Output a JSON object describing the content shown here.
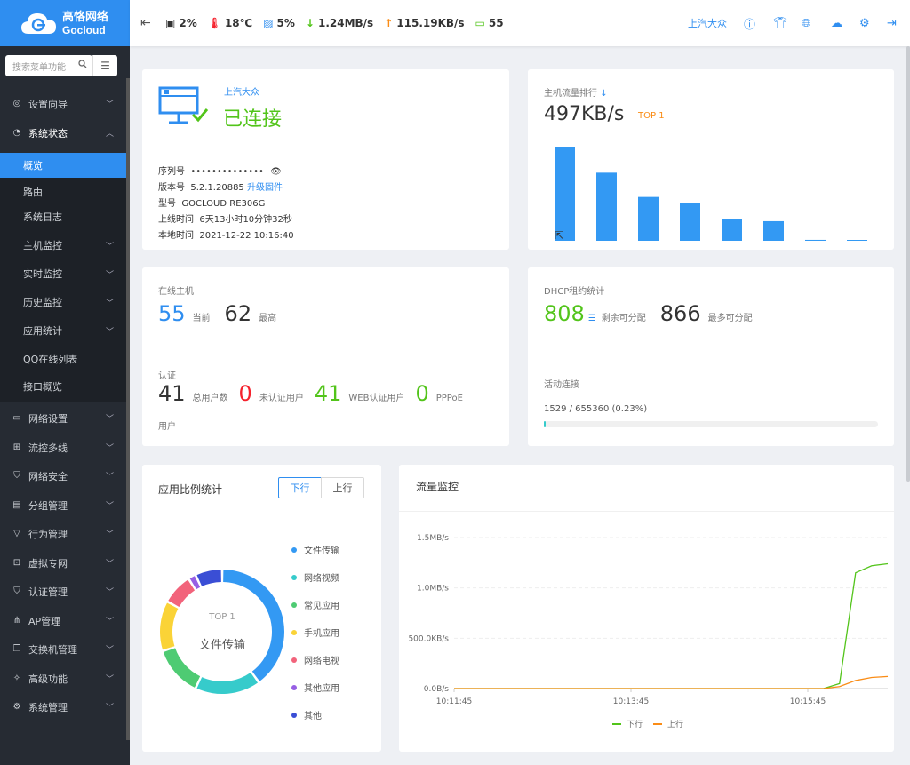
{
  "brand": {
    "cn": "高恪网络",
    "en": "Gocloud"
  },
  "sidebar": {
    "search_placeholder": "搜索菜单功能",
    "groups": [
      {
        "label": "设置向导",
        "icon": "compass-icon"
      },
      {
        "label": "系统状态",
        "icon": "dashboard-icon"
      },
      {
        "label": "网络设置",
        "icon": "monitor-icon"
      },
      {
        "label": "流控多线",
        "icon": "network-icon"
      },
      {
        "label": "网络安全",
        "icon": "shield-icon"
      },
      {
        "label": "分组管理",
        "icon": "list-icon"
      },
      {
        "label": "行为管理",
        "icon": "filter-icon"
      },
      {
        "label": "虚拟专网",
        "icon": "vpn-icon"
      },
      {
        "label": "认证管理",
        "icon": "check-shield-icon"
      },
      {
        "label": "AP管理",
        "icon": "tree-icon"
      },
      {
        "label": "交换机管理",
        "icon": "copy-icon"
      },
      {
        "label": "高级功能",
        "icon": "pin-icon"
      },
      {
        "label": "系统管理",
        "icon": "gear-icon"
      }
    ],
    "status_sub": [
      {
        "label": "概览"
      },
      {
        "label": "路由"
      },
      {
        "label": "系统日志"
      },
      {
        "label": "主机监控"
      },
      {
        "label": "实时监控"
      },
      {
        "label": "历史监控"
      },
      {
        "label": "应用统计"
      },
      {
        "label": "QQ在线列表"
      },
      {
        "label": "接口概览"
      }
    ]
  },
  "topbar": {
    "cpu": "2%",
    "temp": "18℃",
    "mem": "5%",
    "down": "1.24MB/s",
    "up": "115.19KB/s",
    "hosts": "55",
    "user": "上汽大众"
  },
  "device": {
    "name": "上汽大众",
    "status": "已连接",
    "serial_label": "序列号",
    "serial_value": "••••••••••••••",
    "version_label": "版本号",
    "version_value": "5.2.1.20885",
    "upgrade_link": "升级固件",
    "model_label": "型号",
    "model_value": "GOCLOUD RE306G",
    "uptime_label": "上线时间",
    "uptime_value": "6天13小时10分钟32秒",
    "localtime_label": "本地时间",
    "localtime_value": "2021-12-22 10:16:40"
  },
  "ranking": {
    "title": "主机流量排行",
    "value": "497KB/s",
    "badge": "TOP 1"
  },
  "hosts": {
    "title": "在线主机",
    "current": "55",
    "current_label": "当前",
    "max": "62",
    "max_label": "最高",
    "auth_title": "认证",
    "total": "41",
    "total_label": "总用户数",
    "unauth": "0",
    "unauth_label": "未认证用户",
    "web": "41",
    "web_label": "WEB认证用户",
    "pppoe": "0",
    "pppoe_label": "PPPoE",
    "pppoe_label2": "用户"
  },
  "dhcp": {
    "title": "DHCP租约统计",
    "remain": "808",
    "remain_label": "剩余可分配",
    "max": "866",
    "max_label": "最多可分配",
    "conn_title": "活动连接",
    "conn_value": "1529 / 655360 (0.23%)",
    "conn_fraction": 0.0023
  },
  "apps": {
    "title": "应用比例统计",
    "tab_down": "下行",
    "tab_up": "上行",
    "center_top": "TOP 1",
    "center_label": "文件传输",
    "legend": [
      {
        "name": "文件传输",
        "color": "#3399f3"
      },
      {
        "name": "网络视频",
        "color": "#36cbcb"
      },
      {
        "name": "常见应用",
        "color": "#4ecb73"
      },
      {
        "name": "手机应用",
        "color": "#fad337"
      },
      {
        "name": "网络电视",
        "color": "#f2637b"
      },
      {
        "name": "其他应用",
        "color": "#975fe4"
      },
      {
        "name": "其他",
        "color": "#3a4ed5"
      }
    ]
  },
  "chart_data": [
    {
      "type": "bar",
      "values": [
        100,
        73,
        47,
        40,
        23,
        21,
        1,
        0.5
      ],
      "ylim": [
        0,
        100
      ]
    },
    {
      "type": "pie",
      "title": "",
      "categories": [
        "文件传输",
        "网络视频",
        "常见应用",
        "手机应用",
        "网络电视",
        "其他应用",
        "其他"
      ],
      "values": [
        40,
        17,
        13,
        13,
        8,
        2,
        7
      ]
    },
    {
      "type": "line",
      "title": "流量监控",
      "x": [
        "10:11:45",
        "10:13:45",
        "10:15:45"
      ],
      "yticks": [
        "0.0B/s",
        "500.0KB/s",
        "1.0MB/s",
        "1.5MB/s"
      ],
      "ylim": [
        0,
        1.5
      ],
      "series": [
        {
          "name": "下行",
          "color": "#52c41a",
          "values": [
            0,
            0,
            0,
            0,
            0,
            0,
            0,
            0,
            0,
            0,
            0,
            0,
            0,
            0,
            0,
            0,
            0,
            0,
            0,
            0,
            0,
            0,
            0,
            0,
            0.05,
            1.15,
            1.22,
            1.24
          ]
        },
        {
          "name": "上行",
          "color": "#fa8c16",
          "values": [
            0,
            0,
            0,
            0,
            0,
            0,
            0,
            0,
            0,
            0,
            0,
            0,
            0,
            0,
            0,
            0,
            0,
            0,
            0,
            0,
            0,
            0,
            0,
            0,
            0.02,
            0.08,
            0.11,
            0.12
          ]
        }
      ]
    }
  ]
}
